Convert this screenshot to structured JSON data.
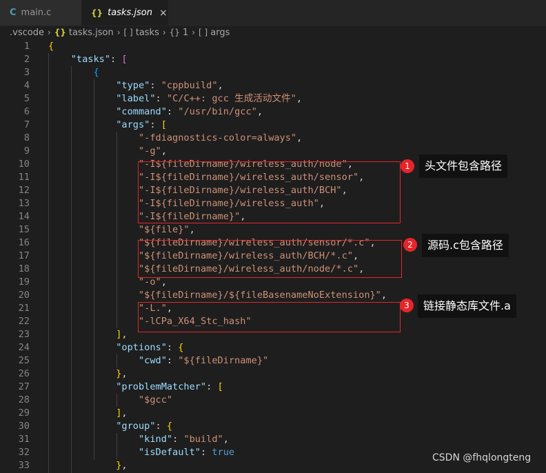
{
  "tabs": [
    {
      "icon": "C",
      "label": "main.c",
      "active": false
    },
    {
      "icon": "{}",
      "label": "tasks.json",
      "active": true,
      "close": "×"
    }
  ],
  "breadcrumb": {
    "folder": ".vscode",
    "file_icon": "{}",
    "file": "tasks.json",
    "arr_icon": "[ ]",
    "tasks": "tasks",
    "obj_icon": "{}",
    "index": "1",
    "arr_icon2": "[ ]",
    "args": "args"
  },
  "code_lines": [
    {
      "n": "1"
    },
    {
      "n": "2"
    },
    {
      "n": "3"
    },
    {
      "n": "4"
    },
    {
      "n": "5"
    },
    {
      "n": "6"
    },
    {
      "n": "7"
    },
    {
      "n": "8"
    },
    {
      "n": "9"
    },
    {
      "n": "10"
    },
    {
      "n": "11"
    },
    {
      "n": "12"
    },
    {
      "n": "13"
    },
    {
      "n": "14"
    },
    {
      "n": "15"
    },
    {
      "n": "16"
    },
    {
      "n": "17"
    },
    {
      "n": "18"
    },
    {
      "n": "19"
    },
    {
      "n": "20"
    },
    {
      "n": "21"
    },
    {
      "n": "22"
    },
    {
      "n": "23"
    },
    {
      "n": "24"
    },
    {
      "n": "25"
    },
    {
      "n": "26"
    },
    {
      "n": "27"
    },
    {
      "n": "28"
    },
    {
      "n": "29"
    },
    {
      "n": "30"
    },
    {
      "n": "31"
    },
    {
      "n": "32"
    },
    {
      "n": "33"
    }
  ],
  "code": {
    "open_brace": "{",
    "k_tasks": "\"tasks\"",
    "k_type": "\"type\"",
    "v_type": "\"cppbuild\"",
    "k_label": "\"label\"",
    "v_label": "\"C/C++: gcc 生成活动文件\"",
    "k_command": "\"command\"",
    "v_command": "\"/usr/bin/gcc\"",
    "k_args": "\"args\"",
    "a1": "\"-fdiagnostics-color=always\"",
    "a2": "\"-g\"",
    "a3": "\"-I${fileDirname}/wireless_auth/node\"",
    "a4": "\"-I${fileDirname}/wireless_auth/sensor\"",
    "a5": "\"-I${fileDirname}/wireless_auth/BCH\"",
    "a6": "\"-I${fileDirname}/wireless_auth\"",
    "a7": "\"-I${fileDirname}\"",
    "a8": "\"${file}\"",
    "a9": "\"${fileDirname}/wireless_auth/sensor/*.c\"",
    "a10": "\"${fileDirname}/wireless_auth/BCH/*.c\"",
    "a11": "\"${fileDirname}/wireless_auth/node/*.c\"",
    "a12": "\"-o\"",
    "a13": "\"${fileDirname}/${fileBasenameNoExtension}\"",
    "a14": "\"-L.\"",
    "a15": "\"-lCPa_X64_Stc_hash\"",
    "k_options": "\"options\"",
    "k_cwd": "\"cwd\"",
    "v_cwd": "\"${fileDirname}\"",
    "k_problemMatcher": "\"problemMatcher\"",
    "v_gcc": "\"$gcc\"",
    "k_group": "\"group\"",
    "k_kind": "\"kind\"",
    "v_kind": "\"build\"",
    "k_isDefault": "\"isDefault\"",
    "v_isDefault": "true"
  },
  "annotations": [
    {
      "num": "1",
      "text": "头文件包含路径"
    },
    {
      "num": "2",
      "text": "源码.c包含路径"
    },
    {
      "num": "3",
      "text": "链接静态库文件.a"
    }
  ],
  "watermark": "CSDN @fhqlongteng",
  "colors": {
    "box": "#e5252a",
    "key": "#9cdcfe",
    "string": "#ce9178"
  }
}
